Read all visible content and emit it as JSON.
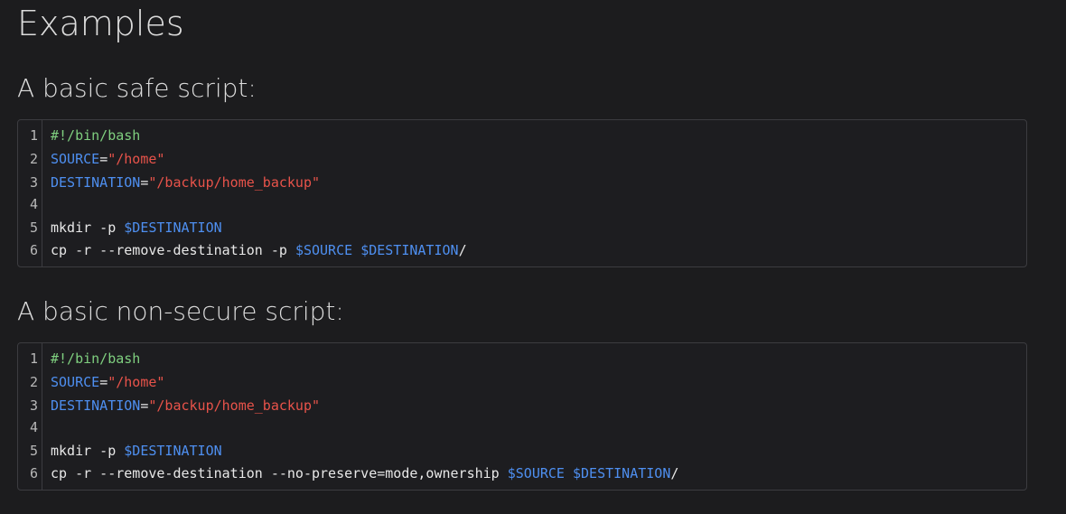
{
  "page": {
    "title": "Examples"
  },
  "sections": [
    {
      "heading": "A basic safe script:",
      "lines": [
        {
          "num": "1",
          "tokens": [
            {
              "type": "comment",
              "text": "#!/bin/bash"
            }
          ]
        },
        {
          "num": "2",
          "tokens": [
            {
              "type": "var",
              "text": "SOURCE"
            },
            {
              "type": "plain",
              "text": "="
            },
            {
              "type": "str",
              "text": "\"/home\""
            }
          ]
        },
        {
          "num": "3",
          "tokens": [
            {
              "type": "var",
              "text": "DESTINATION"
            },
            {
              "type": "plain",
              "text": "="
            },
            {
              "type": "str",
              "text": "\"/backup/home_backup\""
            }
          ]
        },
        {
          "num": "4",
          "tokens": []
        },
        {
          "num": "5",
          "tokens": [
            {
              "type": "plain",
              "text": "mkdir -p "
            },
            {
              "type": "var",
              "text": "$DESTINATION"
            }
          ]
        },
        {
          "num": "6",
          "tokens": [
            {
              "type": "plain",
              "text": "cp -r --remove-destination -p "
            },
            {
              "type": "var",
              "text": "$SOURCE"
            },
            {
              "type": "plain",
              "text": " "
            },
            {
              "type": "var",
              "text": "$DESTINATION"
            },
            {
              "type": "plain",
              "text": "/"
            }
          ]
        }
      ]
    },
    {
      "heading": "A basic non-secure script:",
      "lines": [
        {
          "num": "1",
          "tokens": [
            {
              "type": "comment",
              "text": "#!/bin/bash"
            }
          ]
        },
        {
          "num": "2",
          "tokens": [
            {
              "type": "var",
              "text": "SOURCE"
            },
            {
              "type": "plain",
              "text": "="
            },
            {
              "type": "str",
              "text": "\"/home\""
            }
          ]
        },
        {
          "num": "3",
          "tokens": [
            {
              "type": "var",
              "text": "DESTINATION"
            },
            {
              "type": "plain",
              "text": "="
            },
            {
              "type": "str",
              "text": "\"/backup/home_backup\""
            }
          ]
        },
        {
          "num": "4",
          "tokens": []
        },
        {
          "num": "5",
          "tokens": [
            {
              "type": "plain",
              "text": "mkdir -p "
            },
            {
              "type": "var",
              "text": "$DESTINATION"
            }
          ]
        },
        {
          "num": "6",
          "tokens": [
            {
              "type": "plain",
              "text": "cp -r --remove-destination --no-preserve=mode,ownership "
            },
            {
              "type": "var",
              "text": "$SOURCE"
            },
            {
              "type": "plain",
              "text": " "
            },
            {
              "type": "var",
              "text": "$DESTINATION"
            },
            {
              "type": "plain",
              "text": "/"
            }
          ]
        }
      ]
    }
  ],
  "colors": {
    "background": "#1c1c1e",
    "comment": "#7fcf7f",
    "variable": "#4e8ff0",
    "string": "#e8534a",
    "text": "#e8e8e8"
  }
}
